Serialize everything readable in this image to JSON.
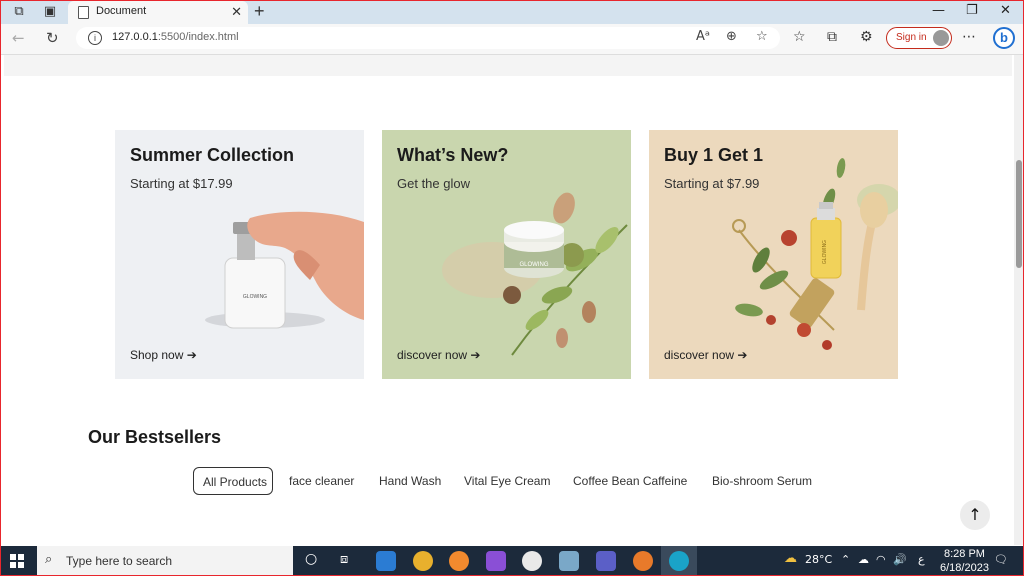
{
  "browser": {
    "tab_title": "Document",
    "url_host": "127.0.0.1",
    "url_rest": ":5500/index.html",
    "sign_in_label": "Sign in"
  },
  "page": {
    "cards": [
      {
        "title": "Summer Collection",
        "subtitle": "Starting at $17.99",
        "cta": "Shop now",
        "product_label": "GLOWING"
      },
      {
        "title": "What’s New?",
        "subtitle": "Get the glow",
        "cta": "discover now",
        "product_label": "GLOWING"
      },
      {
        "title": "Buy 1 Get 1",
        "subtitle": "Starting at $7.99",
        "cta": "discover now",
        "product_label": "GLOWING"
      }
    ],
    "bestsellers_title": "Our Bestsellers",
    "filters": [
      "All Products",
      "face cleaner",
      "Hand Wash",
      "Vital Eye Cream",
      "Coffee Bean Caffeine",
      "Bio-shroom Serum"
    ],
    "active_filter": "All Products",
    "arrow_glyph": "➔",
    "back_to_top_icon": "arrow-up-icon"
  },
  "taskbar": {
    "search_placeholder": "Type here to search",
    "weather": "28°C",
    "time": "8:28 PM",
    "date": "6/18/2023",
    "lang": "ع"
  },
  "colors": {
    "card1_bg": "#eef0f3",
    "card2_bg": "#c9d6ae",
    "card3_bg": "#ecd9bd",
    "sign_in_accent": "#c42b1c",
    "taskbar_bg": "#1c2a3b"
  }
}
